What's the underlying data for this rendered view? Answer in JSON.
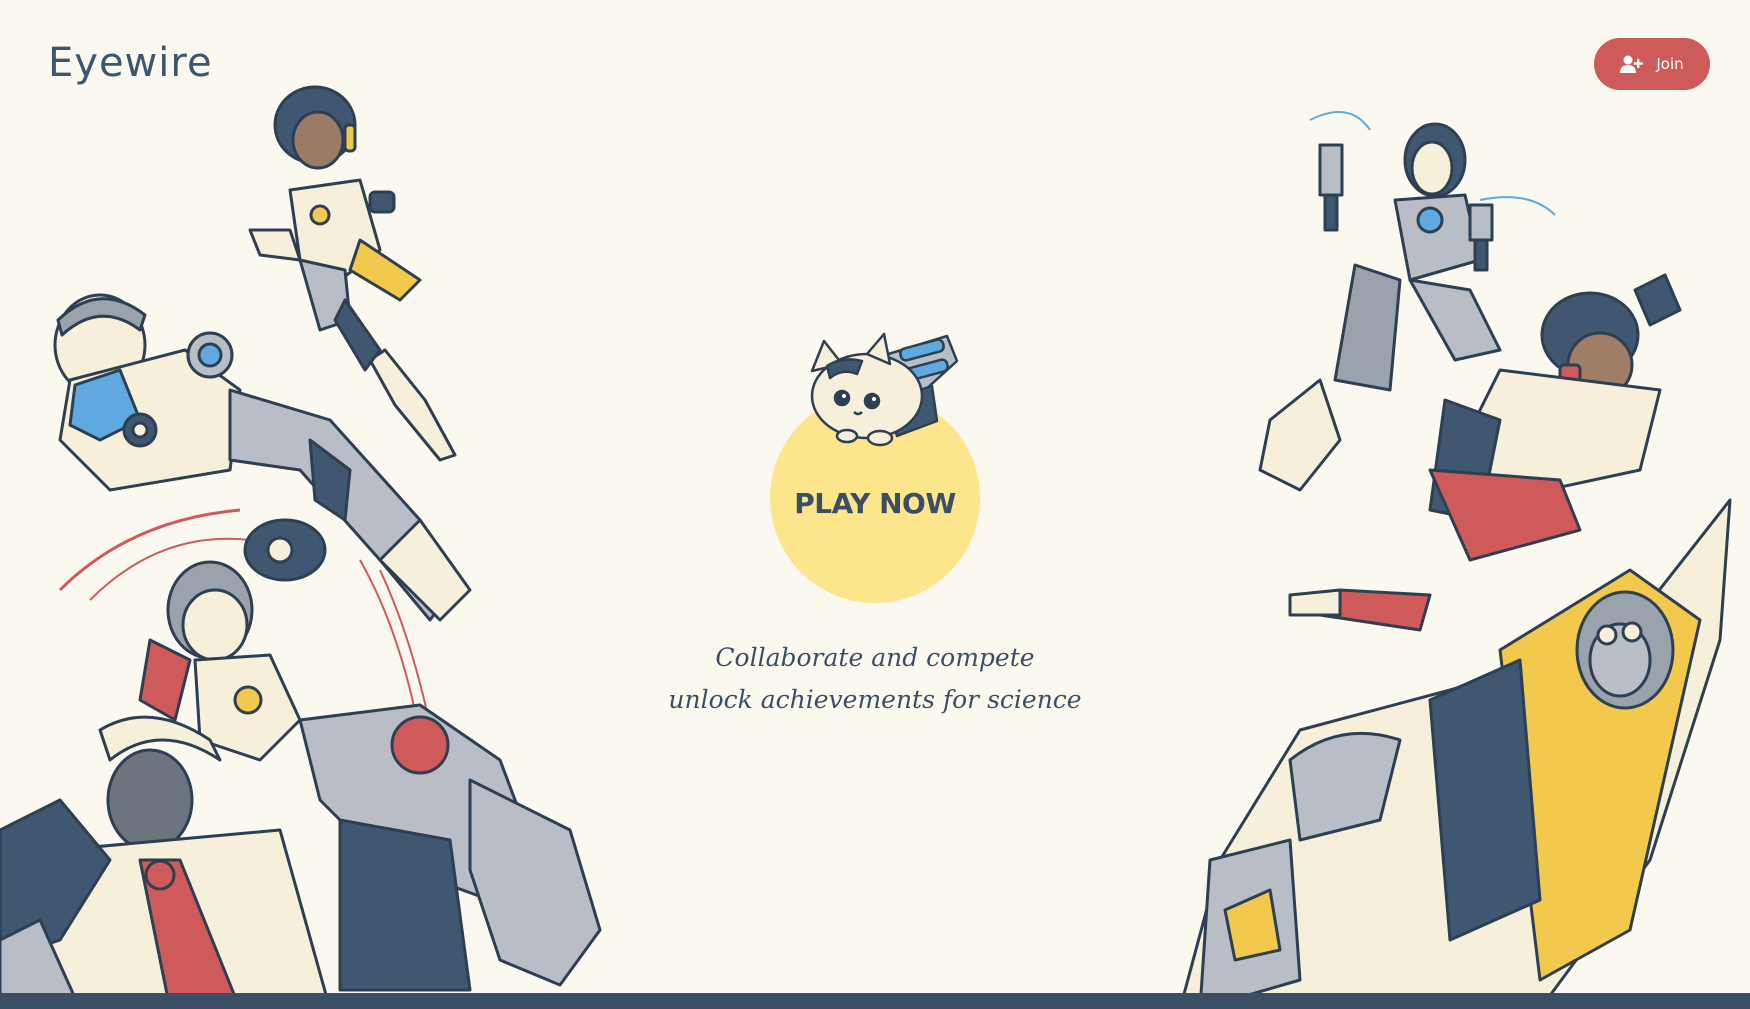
{
  "header": {
    "logo_text": "Eyewire",
    "join_label": "Join"
  },
  "hero": {
    "play_label": "PLAY NOW",
    "tagline_line1": "Collaborate and compete",
    "tagline_line2": "unlock achievements for science"
  },
  "icons": {
    "join": "add-user-icon",
    "mascot": "cat-mascot-icon"
  },
  "colors": {
    "background": "#fbf9ef",
    "brand_text": "#3d5670",
    "join_button": "#cf5a5a",
    "play_circle": "#fde58b",
    "footer_bar": "#3a4f66"
  }
}
